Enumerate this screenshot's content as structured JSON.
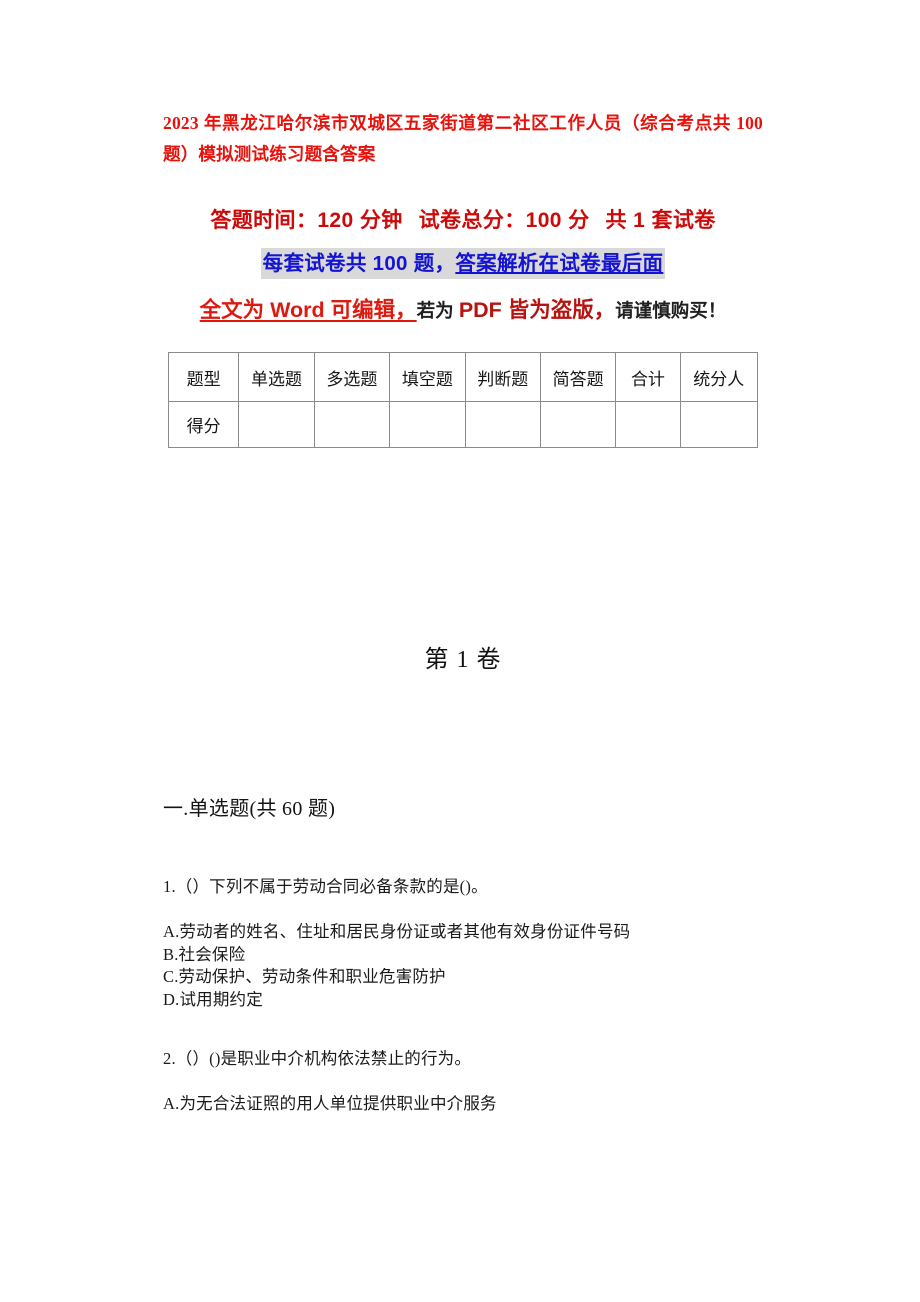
{
  "document": {
    "title_line_1": "2023 年黑龙江哈尔滨市双城区五家街道第二社区工作人员（综合考点共 100",
    "title_line_2": "题）模拟测试练习题含答案",
    "volume_heading": "第 1 卷",
    "section_heading": "一.单选题(共 60 题)"
  },
  "exam_info": {
    "duration_label": "答题时间：120 分钟",
    "total_score_label": "试卷总分：100 分",
    "set_count_label": "共 1 套试卷",
    "per_set_note_part1": "每套试卷共 100 题，",
    "per_set_note_part2": "答案解析在试卷最后面",
    "notice_part1": "全文为 Word 可编辑，",
    "notice_part2": "若为 ",
    "notice_part3": "PDF 皆为盗版，",
    "notice_part4": "请谨慎购买！"
  },
  "score_table": {
    "headers": [
      "题型",
      "单选题",
      "多选题",
      "填空题",
      "判断题",
      "简答题",
      "合计",
      "统分人"
    ],
    "rows": [
      {
        "label": "得分",
        "cells": [
          "",
          "",
          "",
          "",
          "",
          "",
          ""
        ]
      }
    ]
  },
  "questions": [
    {
      "stem": "1.（）下列不属于劳动合同必备条款的是()。",
      "options": [
        "A.劳动者的姓名、住址和居民身份证或者其他有效身份证件号码",
        "B.社会保险",
        "C.劳动保护、劳动条件和职业危害防护",
        "D.试用期约定"
      ]
    },
    {
      "stem": "2.（）()是职业中介机构依法禁止的行为。",
      "options": [
        "A.为无合法证照的用人单位提供职业中介服务"
      ]
    }
  ],
  "colors": {
    "title_red": "#e8120c",
    "info_red": "#cc0a0a",
    "link_blue": "#1414d2",
    "highlight_gray": "#d9d9d9",
    "crimson": "#b71410",
    "body_text": "#1a1a1a"
  }
}
